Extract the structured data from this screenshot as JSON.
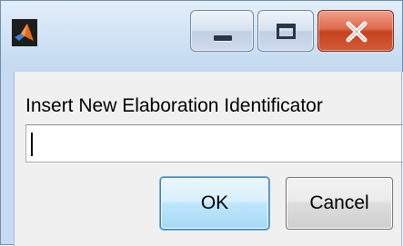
{
  "window": {
    "title": "",
    "app_icon": "matlab-logo-icon",
    "controls": {
      "minimize_icon": "minimize-icon",
      "maximize_icon": "maximize-icon",
      "close_icon": "close-icon"
    },
    "colors": {
      "frame": "#c7dcf2",
      "close_button": "#c7421f",
      "client_bg": "#f0f0f0",
      "default_button_border": "#3c7fb1"
    }
  },
  "dialog": {
    "prompt": "Insert New Elaboration Identificator",
    "input": {
      "value": "",
      "placeholder": ""
    },
    "buttons": {
      "ok_label": "OK",
      "cancel_label": "Cancel"
    }
  }
}
